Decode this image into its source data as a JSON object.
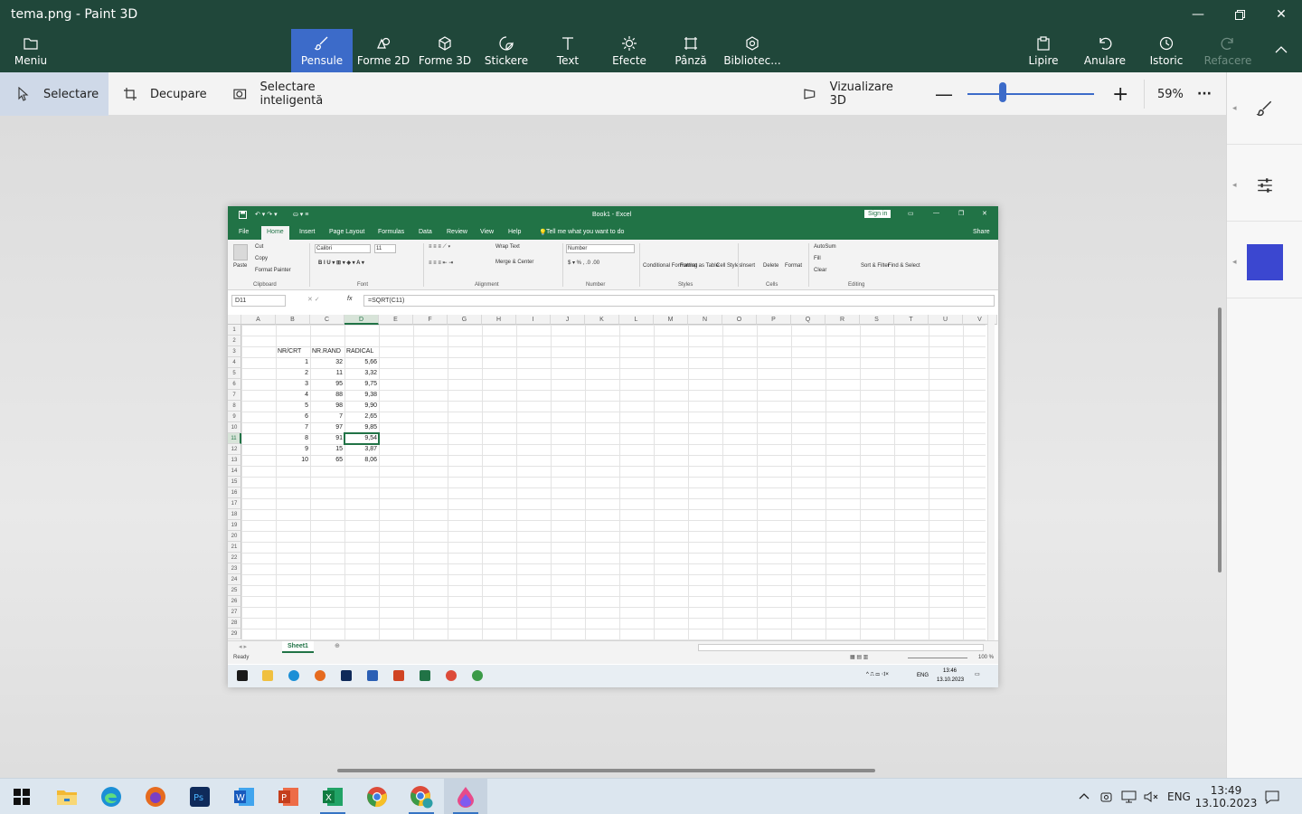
{
  "window": {
    "title": "tema.png - Paint 3D"
  },
  "tabs": [
    {
      "label": "Meniu",
      "icon": "folder-icon"
    },
    {
      "label": "Pensule",
      "icon": "brush-icon",
      "active": true
    },
    {
      "label": "Forme 2D",
      "icon": "shapes-2d-icon"
    },
    {
      "label": "Forme 3D",
      "icon": "cube-icon"
    },
    {
      "label": "Stickere",
      "icon": "sticker-icon"
    },
    {
      "label": "Text",
      "icon": "text-icon"
    },
    {
      "label": "Efecte",
      "icon": "sun-icon"
    },
    {
      "label": "Pânză",
      "icon": "canvas-icon"
    },
    {
      "label": "Bibliotec...",
      "icon": "library-icon"
    },
    {
      "label": "Lipire",
      "icon": "paste-icon"
    },
    {
      "label": "Anulare",
      "icon": "undo-icon"
    },
    {
      "label": "Istoric",
      "icon": "history-icon"
    },
    {
      "label": "Refacere",
      "icon": "redo-icon",
      "disabled": true
    }
  ],
  "toolbar": {
    "select": "Selectare",
    "crop": "Decupare",
    "magic_select": "Selectare inteligentă",
    "view3d": "Vizualizare 3D",
    "zoom": "59%",
    "zoom_level": 0.28,
    "more": "···"
  },
  "colors": {
    "accent": "#3c6bc9",
    "titlebar": "#20473a",
    "swatch": "#3b47d0",
    "excel": "#217346"
  },
  "excel": {
    "title": "Book1 - Excel",
    "sign_in": "Sign in",
    "tabs": [
      "File",
      "Home",
      "Insert",
      "Page Layout",
      "Formulas",
      "Data",
      "Review",
      "View",
      "Help"
    ],
    "tell_me": "Tell me what you want to do",
    "share": "Share",
    "ribbon": {
      "paste": "Paste",
      "cut": "Cut",
      "copy": "Copy",
      "format_painter": "Format Painter",
      "clipboard": "Clipboard",
      "font_name": "Calibri",
      "font_size": "11",
      "font": "Font",
      "wrap_text": "Wrap Text",
      "merge_center": "Merge & Center",
      "alignment": "Alignment",
      "number_format": "Number",
      "number": "Number",
      "conditional": "Conditional Formatting",
      "format_table": "Format as Table",
      "cell_styles": "Cell Styles",
      "styles": "Styles",
      "insert": "Insert",
      "delete": "Delete",
      "format": "Format",
      "cells": "Cells",
      "autosum": "AutoSum",
      "fill": "Fill",
      "clear": "Clear",
      "sort_filter": "Sort & Filter",
      "find_select": "Find & Select",
      "editing": "Editing"
    },
    "name_box": "D11",
    "fx": "fx",
    "formula": "=SQRT(C11)",
    "columns": [
      "A",
      "B",
      "C",
      "D",
      "E",
      "F",
      "G",
      "H",
      "I",
      "J",
      "K",
      "L",
      "M",
      "N",
      "O",
      "P",
      "Q",
      "R",
      "S",
      "T",
      "U",
      "V"
    ],
    "rows": [
      "1",
      "2",
      "3",
      "4",
      "5",
      "6",
      "7",
      "8",
      "9",
      "10",
      "11",
      "12",
      "13",
      "14",
      "15",
      "16",
      "17",
      "18",
      "19",
      "20",
      "21",
      "22",
      "23",
      "24",
      "25",
      "26",
      "27",
      "28",
      "29"
    ],
    "headers": {
      "b": "NR/CRT",
      "c": "NR.RAND",
      "d": "RADICAL"
    },
    "data": [
      {
        "nr": "1",
        "rand": "32",
        "rad": "5,66"
      },
      {
        "nr": "2",
        "rand": "11",
        "rad": "3,32"
      },
      {
        "nr": "3",
        "rand": "95",
        "rad": "9,75"
      },
      {
        "nr": "4",
        "rand": "88",
        "rad": "9,38"
      },
      {
        "nr": "5",
        "rand": "98",
        "rad": "9,90"
      },
      {
        "nr": "6",
        "rand": "7",
        "rad": "2,65"
      },
      {
        "nr": "7",
        "rand": "97",
        "rad": "9,85"
      },
      {
        "nr": "8",
        "rand": "91",
        "rad": "9,54"
      },
      {
        "nr": "9",
        "rand": "15",
        "rad": "3,87"
      },
      {
        "nr": "10",
        "rand": "65",
        "rad": "8,06"
      }
    ],
    "sheet": "Sheet1",
    "status": "Ready",
    "zoom": "100 %",
    "time": "13:46",
    "date": "13.10.2023",
    "lang": "ENG"
  },
  "taskbar": {
    "apps": [
      "start-icon",
      "file-explorer-icon",
      "edge-icon",
      "firefox-icon",
      "photoshop-icon",
      "word-icon",
      "powerpoint-icon",
      "excel-icon",
      "chrome-icon",
      "chrome-profile-icon",
      "paint3d-icon"
    ],
    "lang": "ENG",
    "time": "13:49",
    "date": "13.10.2023"
  }
}
